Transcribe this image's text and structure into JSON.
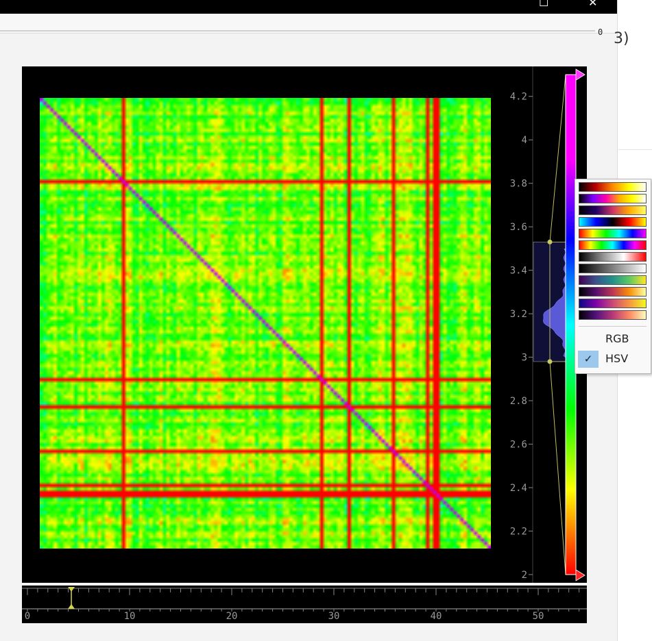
{
  "window": {
    "maximize_glyph": "☐",
    "close_glyph": "✕"
  },
  "top_slider": {
    "value": "0"
  },
  "right_panel": {
    "partial_text": "3)"
  },
  "colorbar": {
    "ticks": [
      "4.2",
      "4",
      "3.8",
      "3.6",
      "3.4",
      "3.2",
      "3",
      "2.8",
      "2.6",
      "2.4",
      "2.2",
      "2"
    ],
    "min": 2.0,
    "max": 4.3,
    "level_low": 2.98,
    "level_high": 3.53
  },
  "timeline": {
    "ticks": [
      "0",
      "10",
      "20",
      "30",
      "40",
      "50"
    ],
    "current": 4.3
  },
  "colormap_menu": {
    "gradients": [
      "thermal",
      "flame",
      "yellowy",
      "bipolar",
      "spectrum",
      "cyclic",
      "greyclip",
      "grey",
      "viridis",
      "inferno",
      "plasma",
      "magma"
    ],
    "items": [
      {
        "label": "RGB",
        "checked": false
      },
      {
        "label": "HSV",
        "checked": true
      }
    ]
  }
}
